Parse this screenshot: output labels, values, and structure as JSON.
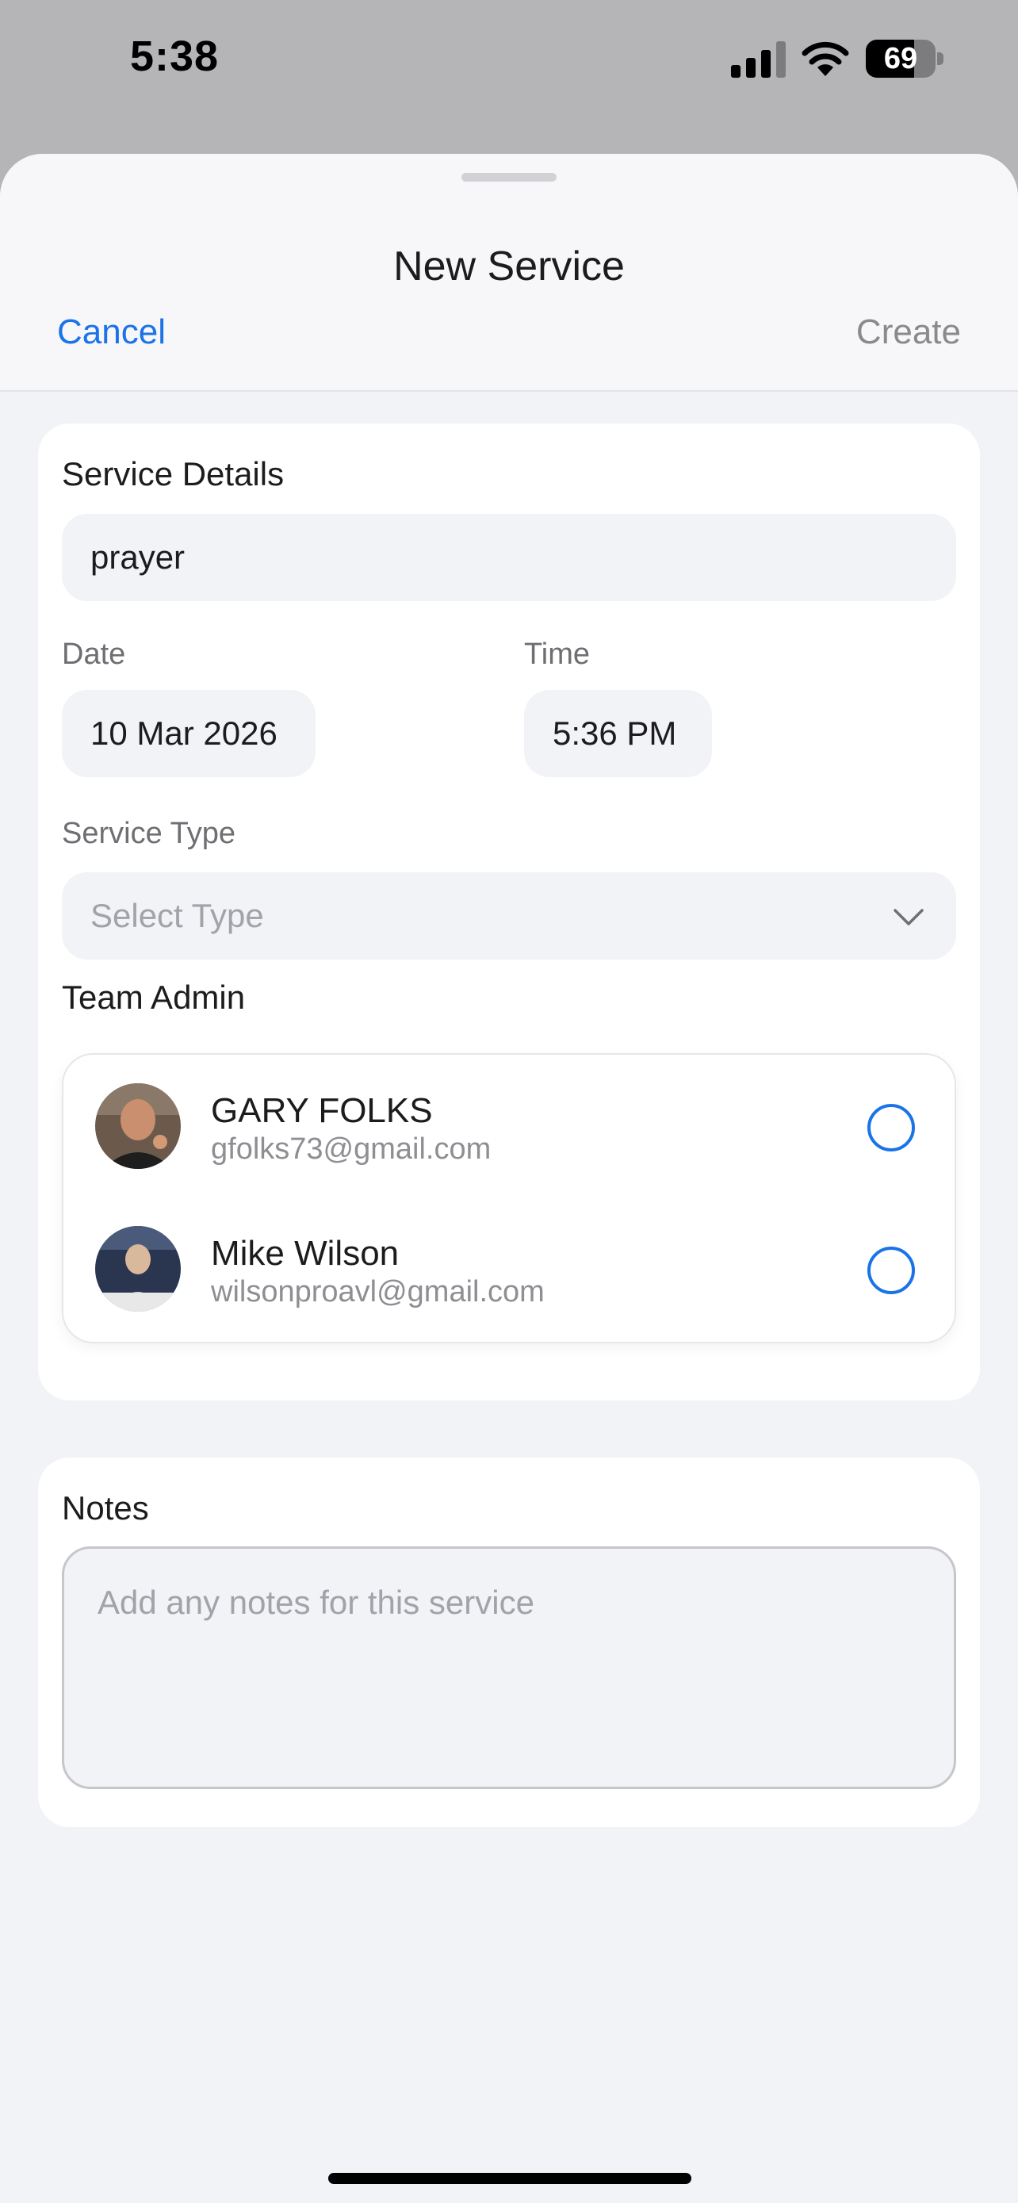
{
  "status_bar": {
    "time": "5:38",
    "battery": "69",
    "battery_level": 0.69
  },
  "sheet": {
    "title": "New Service",
    "cancel_label": "Cancel",
    "create_label": "Create"
  },
  "details": {
    "section_title": "Service Details",
    "name_value": "prayer",
    "date_label": "Date",
    "date_value": "10 Mar 2026",
    "time_label": "Time",
    "time_value": "5:36 PM",
    "type_label": "Service Type",
    "type_placeholder": "Select Type",
    "team_admin_title": "Team Admin",
    "admins": [
      {
        "name": "GARY FOLKS",
        "email": "gfolks73@gmail.com",
        "selected": false
      },
      {
        "name": "Mike Wilson",
        "email": "wilsonproavl@gmail.com",
        "selected": false
      }
    ]
  },
  "notes": {
    "section_title": "Notes",
    "placeholder": "Add any notes for this service"
  },
  "colors": {
    "accent": "#1a73e8",
    "background": "#f2f3f7",
    "card": "#ffffff"
  }
}
